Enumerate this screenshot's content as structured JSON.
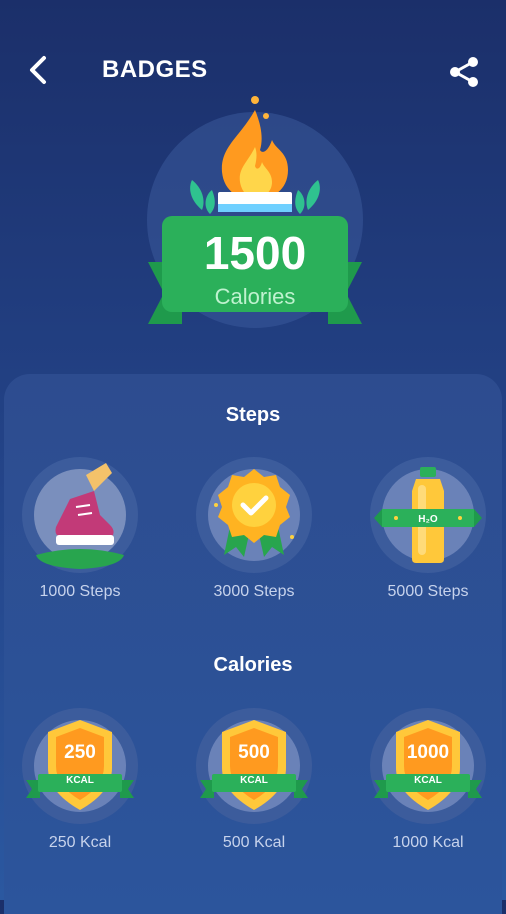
{
  "header": {
    "title": "BADGES",
    "back_icon": "chevron-left-icon",
    "share_icon": "share-icon"
  },
  "hero": {
    "value": "1500",
    "unit": "Calories",
    "icon": "flame-trophy-icon"
  },
  "sections": {
    "steps": {
      "title": "Steps",
      "badges": [
        {
          "label": "1000 Steps",
          "icon": "sneaker-icon"
        },
        {
          "label": "3000 Steps",
          "icon": "medal-check-icon"
        },
        {
          "label": "5000 Steps",
          "icon": "water-bottle-icon",
          "bottle_text": "H₂O"
        }
      ]
    },
    "calories": {
      "title": "Calories",
      "badges": [
        {
          "value": "250",
          "unit": "KCAL",
          "label": "250 Kcal"
        },
        {
          "value": "500",
          "unit": "KCAL",
          "label": "500 Kcal"
        },
        {
          "value": "1000",
          "unit": "KCAL",
          "label": "1000 Kcal"
        }
      ]
    }
  },
  "colors": {
    "background_top": "#1b2f6a",
    "background_bottom": "#2b58a0",
    "green": "#2bb05a",
    "orange": "#ff9a1f",
    "yellow": "#ffc83a"
  }
}
